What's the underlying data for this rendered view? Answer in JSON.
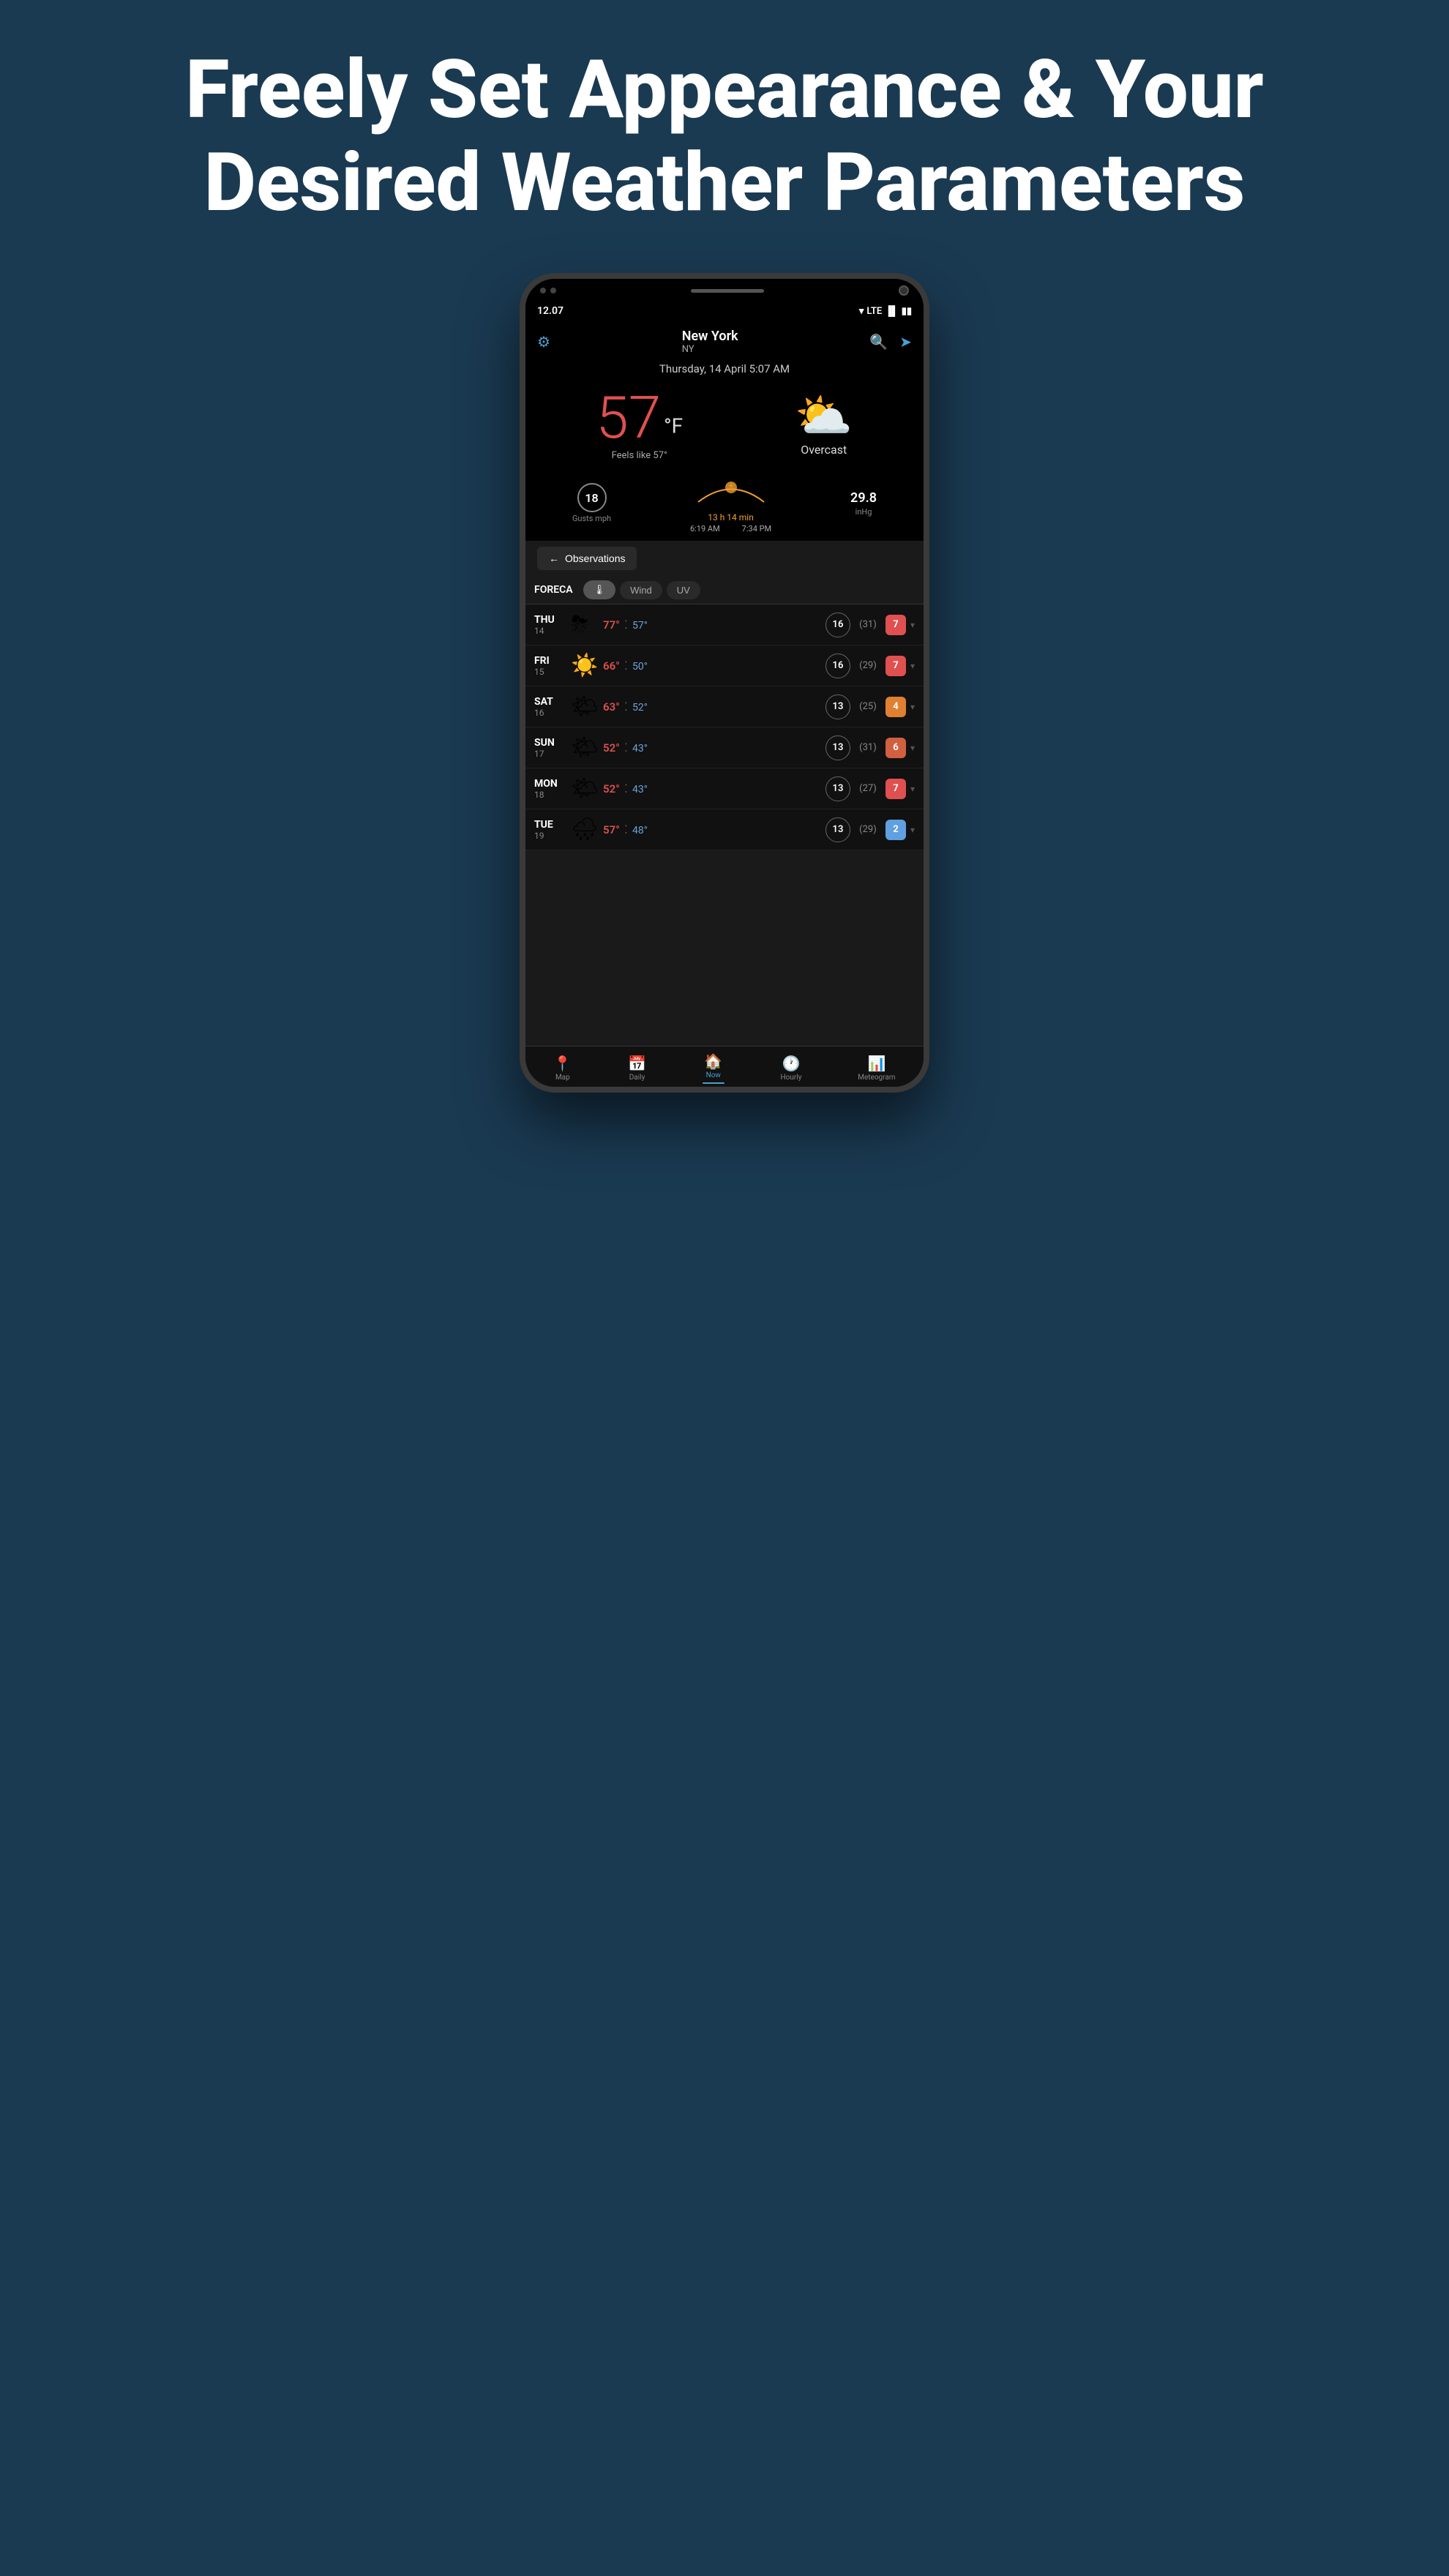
{
  "header": {
    "title": "Freely Set Appearance & Your Desired Weather Parameters"
  },
  "statusBar": {
    "time": "12.07",
    "signal": "LTE"
  },
  "appHeader": {
    "location": "New York",
    "state": "NY",
    "date": "Thursday, 14 April 5:07 AM"
  },
  "weather": {
    "temperature": "57",
    "unit": "°F",
    "feelsLike": "Feels like 57°",
    "condition": "Overcast",
    "gusts": "18",
    "gustsLabel": "Gusts mph",
    "sunriseTime": "6:19 AM",
    "sunsetTime": "7:34 PM",
    "sunDuration": "13 h 14 min",
    "pressure": "29.8",
    "pressureUnit": "inHg"
  },
  "observations": {
    "buttonLabel": "Observations",
    "backArrow": "←"
  },
  "tabs": {
    "logo": "FORECA",
    "thermometer": "🌡",
    "wind": "Wind",
    "uv": "UV"
  },
  "forecast": [
    {
      "dayName": "THU",
      "dayNum": "14",
      "icon": "⛈",
      "highTemp": "77°",
      "lowTemp": "57°",
      "wind": "16",
      "windMph": "(31)",
      "uv": "7",
      "uvClass": "uv-high"
    },
    {
      "dayName": "FRI",
      "dayNum": "15",
      "icon": "☀️",
      "highTemp": "66°",
      "lowTemp": "50°",
      "wind": "16",
      "windMph": "(29)",
      "uv": "7",
      "uvClass": "uv-high"
    },
    {
      "dayName": "SAT",
      "dayNum": "16",
      "icon": "🌤",
      "highTemp": "63°",
      "lowTemp": "52°",
      "wind": "13",
      "windMph": "(25)",
      "uv": "4",
      "uvClass": "uv-med"
    },
    {
      "dayName": "SUN",
      "dayNum": "17",
      "icon": "🌤",
      "highTemp": "52°",
      "lowTemp": "43°",
      "wind": "13",
      "windMph": "(31)",
      "uv": "6",
      "uvClass": "uv-high"
    },
    {
      "dayName": "MON",
      "dayNum": "18",
      "icon": "🌤",
      "highTemp": "52°",
      "lowTemp": "43°",
      "wind": "13",
      "windMph": "(27)",
      "uv": "7",
      "uvClass": "uv-high"
    },
    {
      "dayName": "TUE",
      "dayNum": "19",
      "icon": "🌧",
      "highTemp": "57°",
      "lowTemp": "48°",
      "wind": "13",
      "windMph": "(29)",
      "uv": "2",
      "uvClass": "uv-low"
    }
  ],
  "bottomNav": [
    {
      "icon": "📍",
      "label": "Map",
      "active": false
    },
    {
      "icon": "📅",
      "label": "Daily",
      "active": false
    },
    {
      "icon": "🏠",
      "label": "Now",
      "active": true
    },
    {
      "icon": "🕐",
      "label": "Hourly",
      "active": false
    },
    {
      "icon": "📊",
      "label": "Meteogram",
      "active": false
    }
  ]
}
